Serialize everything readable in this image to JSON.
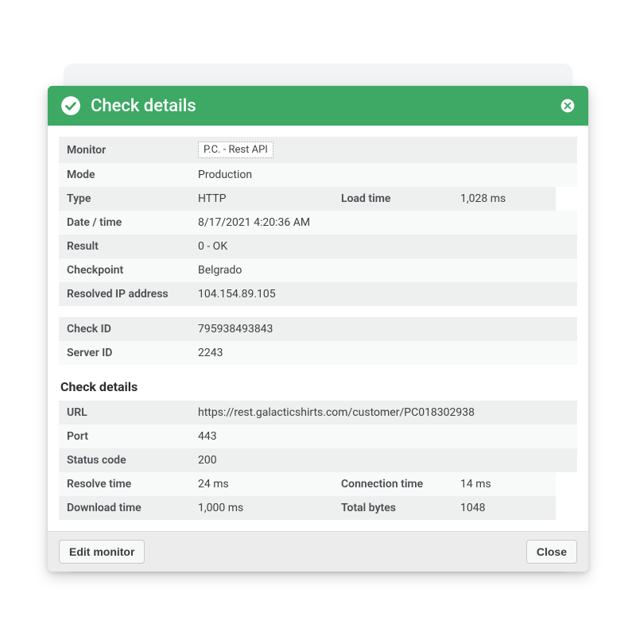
{
  "header": {
    "title": "Check details"
  },
  "group1": {
    "monitor_label": "Monitor",
    "monitor_value": "P.C. - Rest API",
    "mode_label": "Mode",
    "mode_value": "Production",
    "type_label": "Type",
    "type_value": "HTTP",
    "load_time_label": "Load time",
    "load_time_value": "1,028 ms",
    "datetime_label": "Date / time",
    "datetime_value": "8/17/2021 4:20:36 AM",
    "result_label": "Result",
    "result_value": "0 - OK",
    "checkpoint_label": "Checkpoint",
    "checkpoint_value": "Belgrado",
    "resolved_ip_label": "Resolved IP address",
    "resolved_ip_value": "104.154.89.105"
  },
  "group2": {
    "check_id_label": "Check ID",
    "check_id_value": "795938493843",
    "server_id_label": "Server ID",
    "server_id_value": "2243"
  },
  "section_title": "Check details",
  "group3": {
    "url_label": "URL",
    "url_value": "https://rest.galacticshirts.com/customer/PC018302938",
    "port_label": "Port",
    "port_value": "443",
    "status_code_label": "Status code",
    "status_code_value": "200",
    "resolve_time_label": "Resolve time",
    "resolve_time_value": "24 ms",
    "connection_time_label": "Connection time",
    "connection_time_value": "14 ms",
    "download_time_label": "Download time",
    "download_time_value": "1,000 ms",
    "total_bytes_label": "Total bytes",
    "total_bytes_value": "1048"
  },
  "footer": {
    "edit_monitor_label": "Edit monitor",
    "close_label": "Close"
  }
}
